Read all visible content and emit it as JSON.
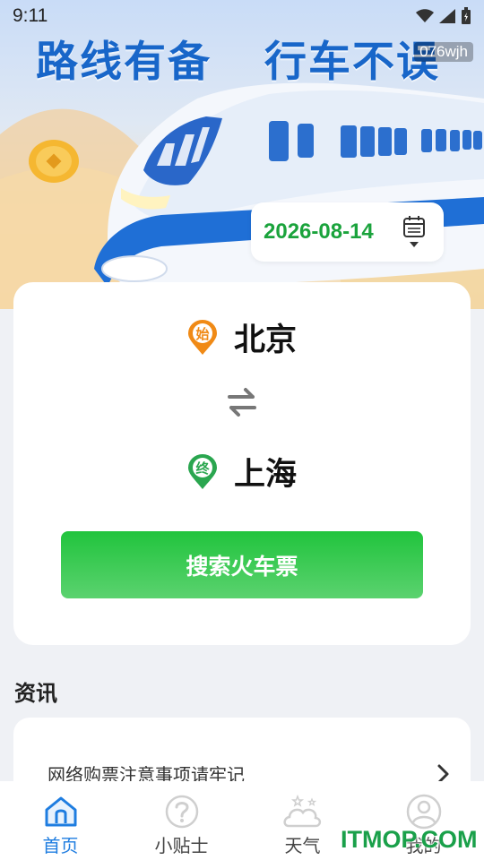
{
  "status_bar": {
    "time": "9:11"
  },
  "hero": {
    "slogan_left": "路线有备",
    "slogan_right": "行车不误",
    "watermark": "076wjh"
  },
  "date": "2026-08-14",
  "stations": {
    "from": {
      "badge": "始",
      "name": "北京"
    },
    "to": {
      "badge": "终",
      "name": "上海"
    }
  },
  "search_button": "搜索火车票",
  "news": {
    "title": "资讯",
    "items": [
      {
        "text": "网络购票注意事项请牢记"
      }
    ]
  },
  "nav": {
    "items": [
      {
        "label": "首页",
        "icon": "home-icon",
        "active": true
      },
      {
        "label": "小贴士",
        "icon": "question-icon",
        "active": false
      },
      {
        "label": "天气",
        "icon": "weather-icon",
        "active": false
      },
      {
        "label": "我的",
        "icon": "profile-icon",
        "active": false
      }
    ]
  },
  "watermark_bottom": "ITMOP.COM",
  "colors": {
    "brand_blue": "#1866c9",
    "accent_green": "#1aa33c",
    "active_nav": "#1f7de0",
    "from_badge": "#f08a16",
    "to_badge": "#2aa64f"
  }
}
